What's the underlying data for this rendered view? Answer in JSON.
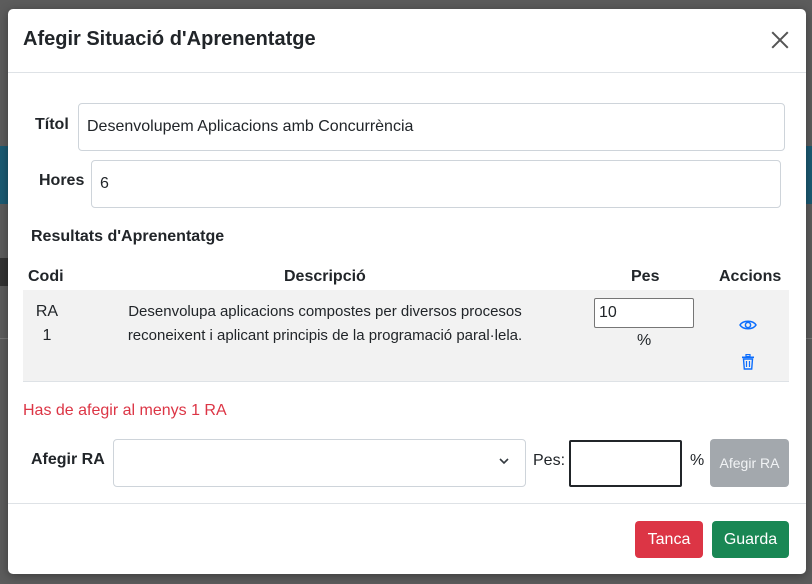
{
  "modal": {
    "title": "Afegir Situació d'Aprenentatge",
    "close_icon": "close-icon"
  },
  "form": {
    "titol_label": "Títol",
    "titol_value": "Desenvolupem Aplicacions amb Concurrència",
    "hores_label": "Hores",
    "hores_value": "6",
    "section_title": "Resultats d'Aprenentatge"
  },
  "table": {
    "headers": [
      "Codi",
      "Descripció",
      "Pes",
      "Accions"
    ],
    "rows": [
      {
        "code_line1": "RA",
        "code_line2": "1",
        "description": "Desenvolupa aplicacions compostes per diversos procesos reconeixent i aplicant principis de la programació paral·lela.",
        "pes": "10",
        "pes_unit": "%",
        "actions": [
          "eye-icon",
          "trash-icon"
        ]
      }
    ]
  },
  "error_message": "Has de afegir al menys 1 RA",
  "add_ra": {
    "label": "Afegir RA",
    "select_value": "",
    "pes_label": "Pes:",
    "pes_value": "",
    "pes_unit": "%",
    "button_label": "Afegir RA"
  },
  "footer": {
    "tanca_label": "Tanca",
    "guarda_label": "Guarda"
  },
  "colors": {
    "danger": "#dc3545",
    "success": "#198754",
    "secondary_disabled": "#a3a8ad",
    "link_icon": "#0d6efd"
  }
}
